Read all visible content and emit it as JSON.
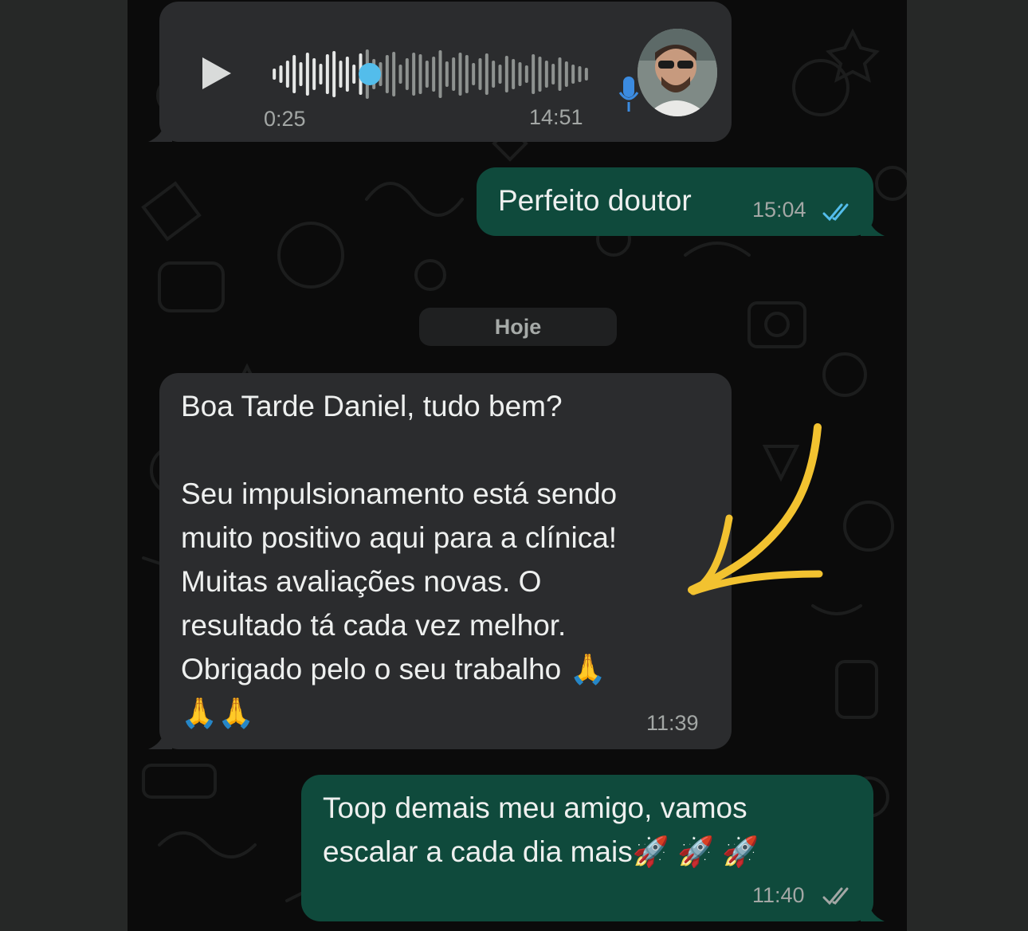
{
  "conversation": {
    "voice_message": {
      "elapsed": "0:25",
      "time": "14:51",
      "progress": 0.3
    },
    "reply_1": {
      "text": "Perfeito doutor",
      "time": "15:04",
      "status_icon": "double-check-icon"
    },
    "date_separator": "Hoje",
    "incoming_text": {
      "text": "Boa Tarde Daniel, tudo bem?\n\nSeu impulsionamento está sendo\nmuito positivo aqui para a clínica!\nMuitas avaliações novas. O\nresultado tá cada vez melhor.\nObrigado pelo o seu trabalho 🙏\n🙏🙏",
      "time": "11:39"
    },
    "reply_2": {
      "text": "Toop demais meu amigo, vamos\nescalar a cada dia mais🚀 🚀 🚀",
      "time": "11:40",
      "status_icon": "double-check-icon"
    }
  },
  "colors": {
    "incoming_bubble": "#2b2c2e",
    "outgoing_bubble": "#0f4a3c",
    "read_receipt": "#53bdeb",
    "annotation_arrow": "#f2c230"
  }
}
